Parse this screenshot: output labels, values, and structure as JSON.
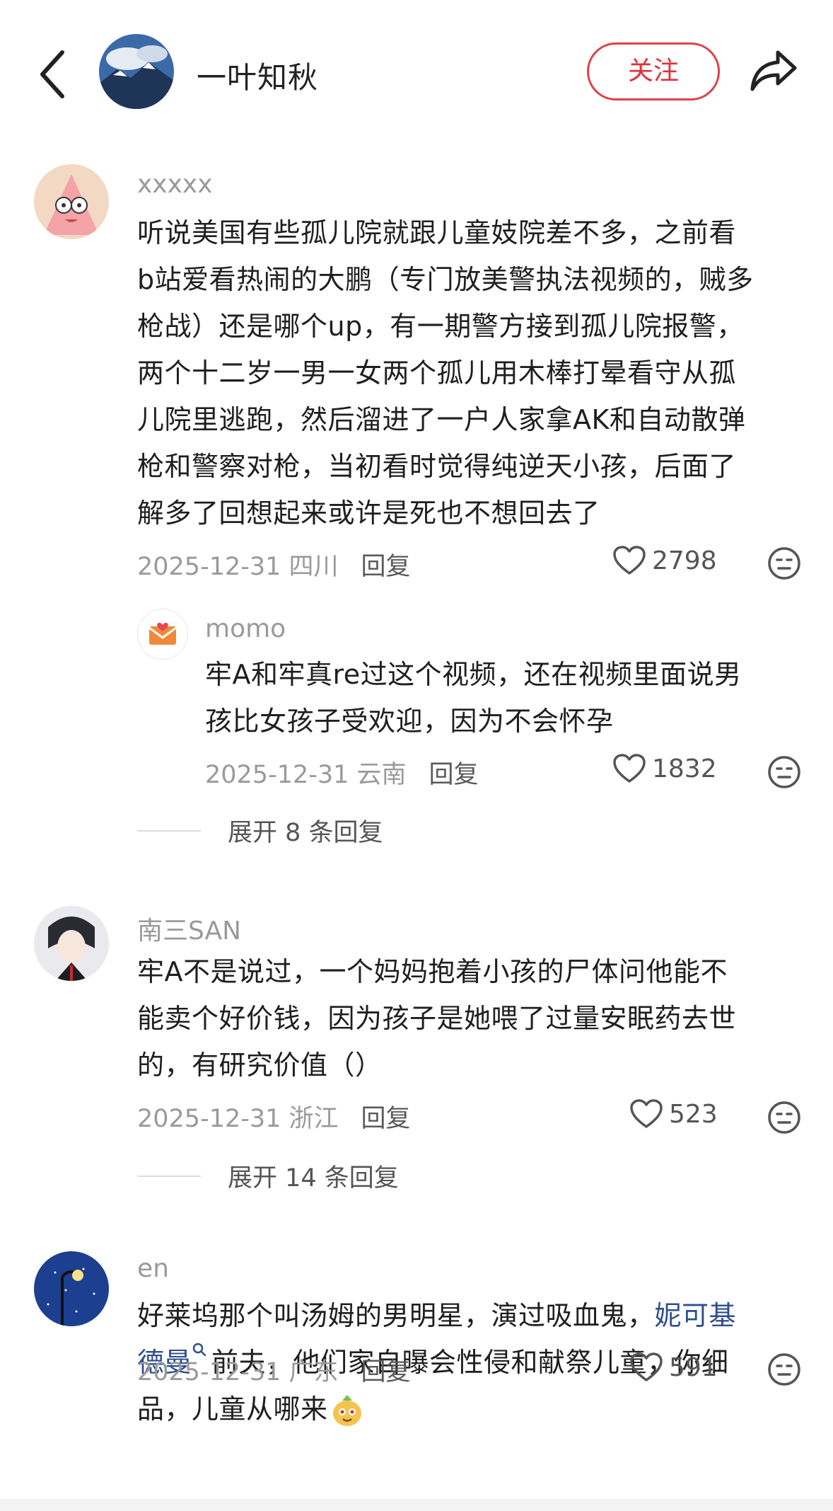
{
  "header": {
    "title": "一叶知秋",
    "follow_label": "关注"
  },
  "comments": [
    {
      "username": "xxxxx",
      "lines": [
        "听说美国有些孤儿院就跟儿童妓院差不多，之前看",
        "b站爱看热闹的大鹏（专门放美警执法视频的，贼多",
        "枪战）还是哪个up，有一期警方接到孤儿院报警，",
        "两个十二岁一男一女两个孤儿用木棒打晕看守从孤",
        "儿院里逃跑，然后溜进了一户人家拿AK和自动散弹",
        "枪和警察对枪，当初看时觉得纯逆天小孩，后面了",
        "解多了回想起来或许是死也不想回去了"
      ],
      "meta": "2025-12-31 四川",
      "reply_label": "回复",
      "likes": "2798"
    },
    {
      "username": "momo",
      "lines": [
        "牢A和牢真re过这个视频，还在视频里面说男",
        "孩比女孩子受欢迎，因为不会怀孕"
      ],
      "meta": "2025-12-31 云南",
      "reply_label": "回复",
      "likes": "1832",
      "expand": "展开 8 条回复"
    },
    {
      "username": "南三SAN",
      "lines": [
        "牢A不是说过，一个妈妈抱着小孩的尸体问他能不",
        "能卖个好价钱，因为孩子是她喂了过量安眠药去世",
        "的，有研究价值（）"
      ],
      "meta": "2025-12-31 浙江",
      "reply_label": "回复",
      "likes": "523",
      "expand": "展开 14 条回复"
    },
    {
      "username": "en",
      "line1_prefix": "好莱坞那个叫汤姆的男明星，演过吸血鬼，",
      "link_part1": "妮可基",
      "link_part2": "德曼",
      "line2_suffix": "前夫，他们家自曝会性侵和献祭儿童，你细",
      "line3": "品，儿童从哪来",
      "meta": "2025-12-31 广东",
      "reply_label": "回复",
      "likes": "591"
    }
  ],
  "colors": {
    "accent_red": "#e0313a",
    "link_blue": "#2d4e8e",
    "meta_gray": "#9a9a9a"
  },
  "icons": [
    "back-icon",
    "share-icon",
    "heart-icon",
    "emoji-face-icon",
    "search-icon"
  ]
}
